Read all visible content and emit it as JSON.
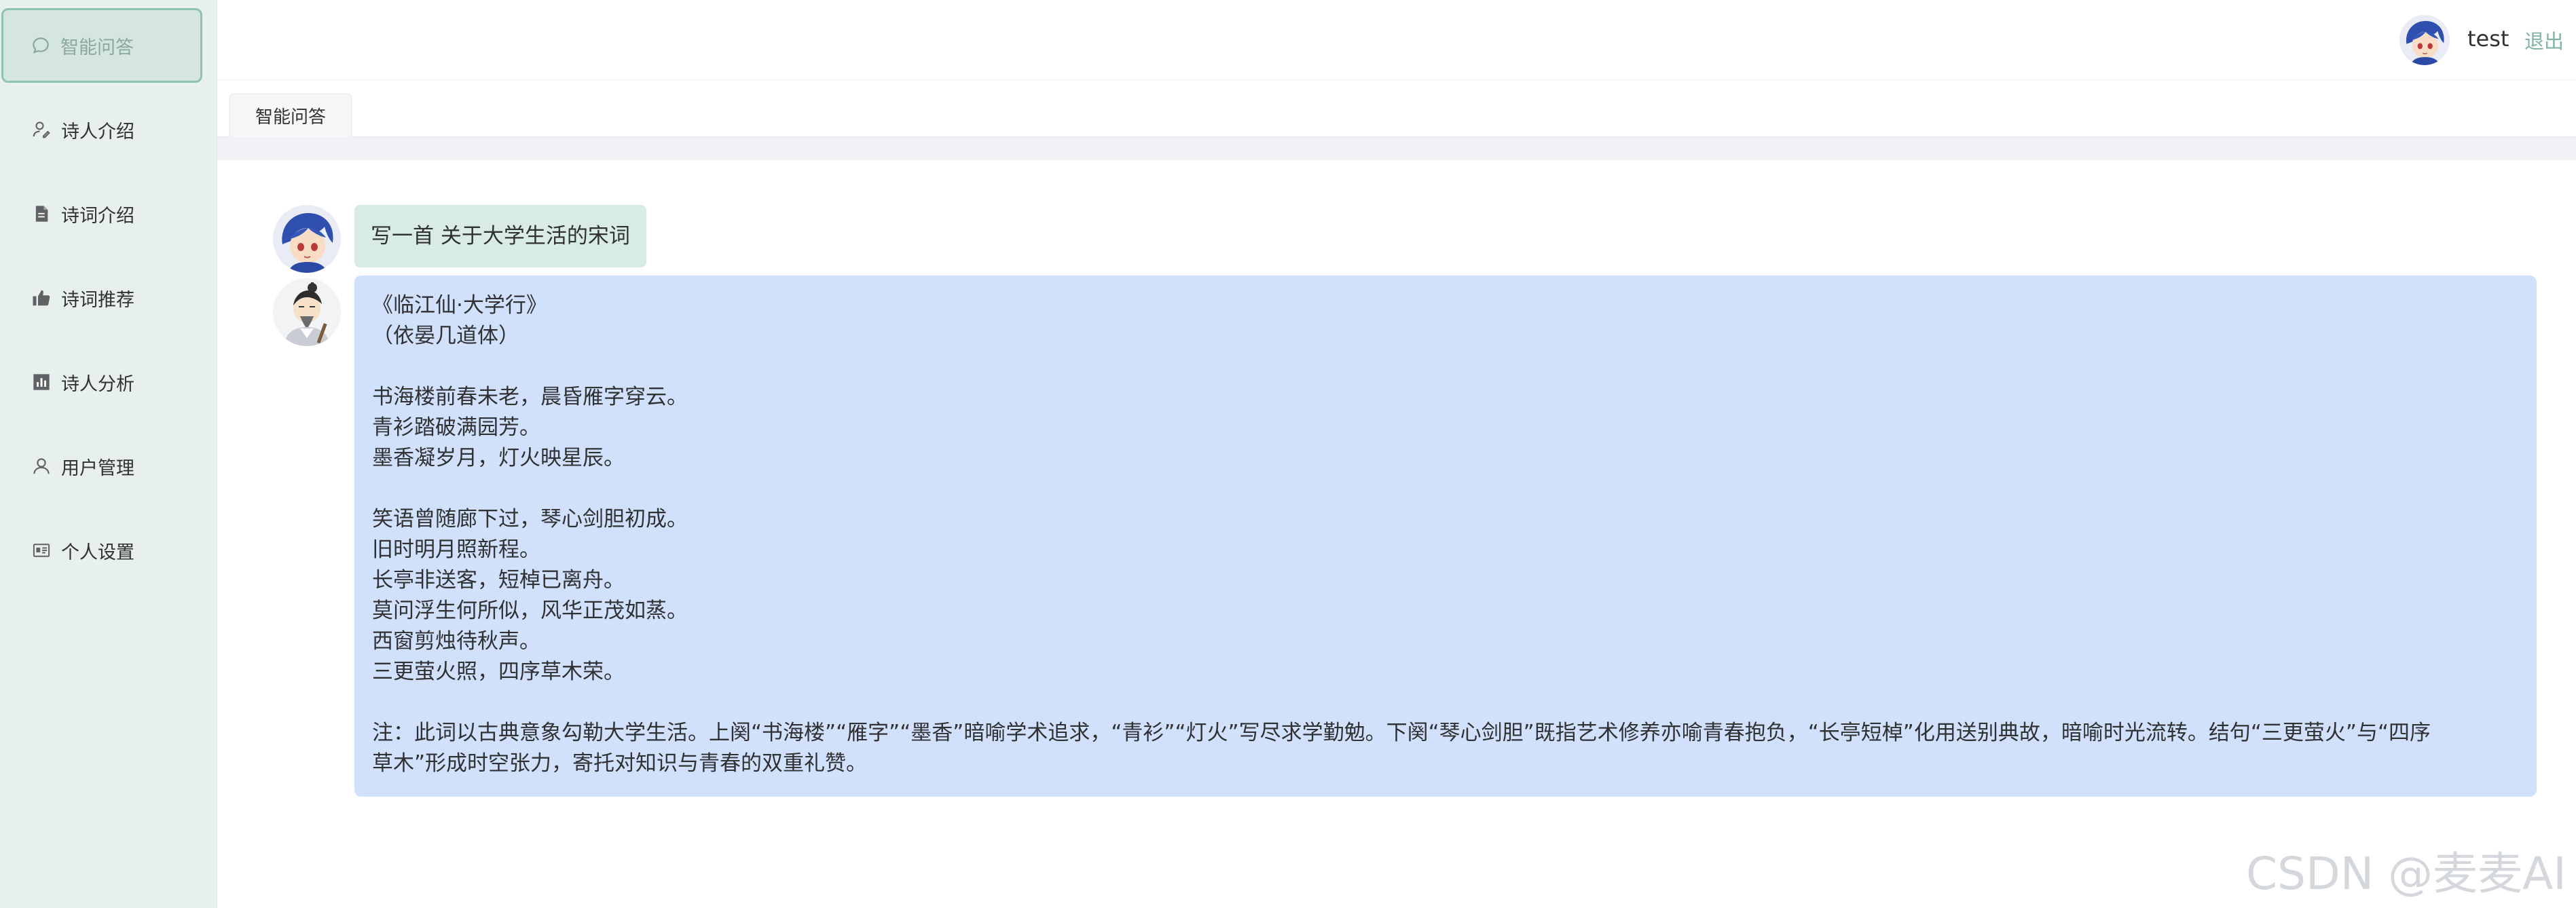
{
  "sidebar": {
    "items": [
      {
        "label": "智能问答",
        "icon": "chat-bubble-icon",
        "active": true
      },
      {
        "label": "诗人介绍",
        "icon": "user-edit-icon",
        "active": false
      },
      {
        "label": "诗词介绍",
        "icon": "document-icon",
        "active": false
      },
      {
        "label": "诗词推荐",
        "icon": "thumbs-up-icon",
        "active": false
      },
      {
        "label": "诗人分析",
        "icon": "bar-chart-icon",
        "active": false
      },
      {
        "label": "用户管理",
        "icon": "users-icon",
        "active": false
      },
      {
        "label": "个人设置",
        "icon": "id-card-icon",
        "active": false
      }
    ]
  },
  "header": {
    "username": "test",
    "logout_label": "退出"
  },
  "tabs": [
    {
      "label": "智能问答",
      "active": true
    }
  ],
  "chat": {
    "question": "写一首 关于大学生活的宋词",
    "answer_lines": [
      "《临江仙·大学行》",
      "（依晏几道体）",
      "",
      "书海楼前春未老，晨昏雁字穿云。",
      "青衫踏破满园芳。",
      "墨香凝岁月，灯火映星辰。",
      "",
      "笑语曾随廊下过，琴心剑胆初成。",
      "旧时明月照新程。",
      "长亭非送客，短棹已离舟。",
      "莫问浮生何所似，风华正茂如蒸。",
      "西窗剪烛待秋声。",
      "三更萤火照，四序草木荣。",
      "",
      "注：此词以古典意象勾勒大学生活。上阕“书海楼”“雁字”“墨香”暗喻学术追求，“青衫”“灯火”写尽求学勤勉。下阕“琴心剑胆”既指艺术修养亦喻青春抱负，“长亭短棹”化用送别典故，暗喻时光流转。结句“三更萤火”与“四序",
      "草木”形成时空张力，寄托对知识与青春的双重礼赞。"
    ]
  },
  "watermark": "CSDN @麦麦AI",
  "colors": {
    "sidebar_bg": "#e8f0ee",
    "active_border": "#8ec3b2",
    "question_bg": "#d9ebe5",
    "answer_bg": "#d1e0fb",
    "logout": "#7fb3a5"
  }
}
